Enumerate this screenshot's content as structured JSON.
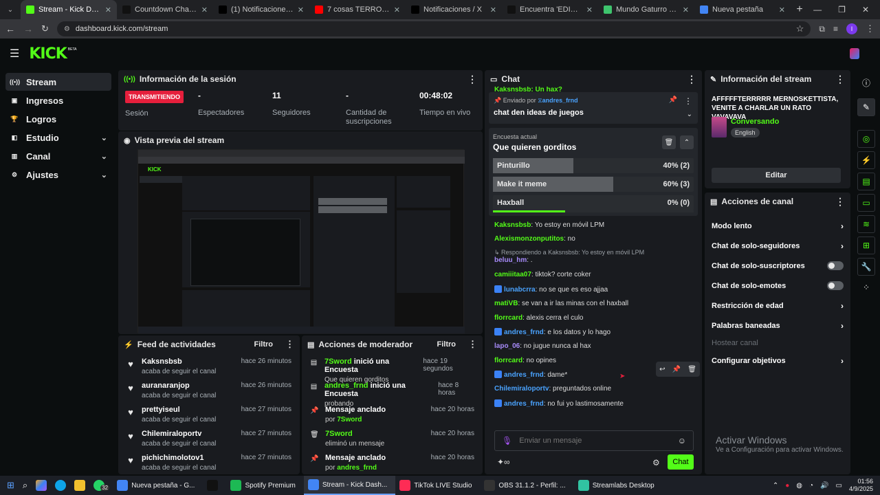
{
  "browser": {
    "tabs": [
      {
        "title": "Stream - Kick Dashboard",
        "color": "#53fc18",
        "active": true
      },
      {
        "title": "Countdown Challenge wi",
        "color": "#111111"
      },
      {
        "title": "(1) Notificaciones / X",
        "color": "#000000"
      },
      {
        "title": "7 cosas TERRORIFICAS co",
        "color": "#ff0000"
      },
      {
        "title": "Notificaciones / X",
        "color": "#000000"
      },
      {
        "title": "Encuentra 'EDIT MESSI YO",
        "color": "#111111"
      },
      {
        "title": "Mundo Gaturro - Login",
        "color": "#3ec46d"
      },
      {
        "title": "Nueva pestaña",
        "color": "#4285f4"
      }
    ],
    "url": "dashboard.kick.com/stream",
    "profile": "I"
  },
  "logo": {
    "text": "KICK",
    "badge": "BETA"
  },
  "sidebar": {
    "items": [
      {
        "label": "Stream",
        "icon": "broadcast-icon",
        "active": true
      },
      {
        "label": "Ingresos",
        "icon": "wallet-icon"
      },
      {
        "label": "Logros",
        "icon": "trophy-icon"
      },
      {
        "label": "Estudio",
        "icon": "studio-icon",
        "chevron": true
      },
      {
        "label": "Canal",
        "icon": "channel-icon",
        "chevron": true
      },
      {
        "label": "Ajustes",
        "icon": "gear-icon",
        "chevron": true
      }
    ]
  },
  "session": {
    "title": "Información de la sesión",
    "live": "TRANSMITIENDO",
    "session_label": "Sesión",
    "stats": [
      {
        "value": "-",
        "label": "Espectadores"
      },
      {
        "value": "11",
        "label": "Seguidores"
      },
      {
        "value": "-",
        "label": "Cantidad de suscripciones"
      },
      {
        "value": "00:48:02",
        "label": "Tiempo en vivo"
      }
    ]
  },
  "preview": {
    "title": "Vista previa del stream"
  },
  "feed": {
    "title": "Feed de actividades",
    "filter": "Filtro",
    "items": [
      {
        "name": "Kaksnsbsb",
        "sub": "acaba de seguir el canal",
        "time": "hace 26 minutos"
      },
      {
        "name": "auranaranjop",
        "sub": "acaba de seguir el canal",
        "time": "hace 26 minutos"
      },
      {
        "name": "prettyiseul",
        "sub": "acaba de seguir el canal",
        "time": "hace 27 minutos"
      },
      {
        "name": "Chilemiraloportv",
        "sub": "acaba de seguir el canal",
        "time": "hace 27 minutos"
      },
      {
        "name": "pichichimolotov1",
        "sub": "acaba de seguir el canal",
        "time": "hace 27 minutos"
      }
    ]
  },
  "modactions": {
    "title": "Acciones de moderador",
    "filter": "Filtro",
    "items": [
      {
        "user": "7Sword",
        "action": " inició una Encuesta",
        "sub": "Que quieren gorditos",
        "time": "hace 19 segundos",
        "icon": "poll-icon"
      },
      {
        "user": "andres_frnd",
        "action": " inició una Encuesta",
        "sub": "probando",
        "time": "hace 8 horas",
        "icon": "poll-icon"
      },
      {
        "user": "",
        "action": "Mensaje anclado",
        "sub_prefix": "por ",
        "sub": "7Sword",
        "time": "hace 20 horas",
        "icon": "pin-icon"
      },
      {
        "user": "7Sword",
        "action": "",
        "sub": "eliminó un mensaje",
        "time": "hace 20 horas",
        "icon": "trash-icon"
      },
      {
        "user": "",
        "action": "Mensaje anclado",
        "sub_prefix": "por ",
        "sub": "andres_frnd",
        "time": "hace 20 horas",
        "icon": "pin-icon"
      }
    ]
  },
  "chat": {
    "title": "Chat",
    "top_partial": "Kaksnsbsb: Un hax?",
    "pinned": {
      "by_label": "Enviado por",
      "by": "andres_frnd",
      "text": "chat den ideas de juegos"
    },
    "poll": {
      "label": "Encuesta actual",
      "question": "Que quieren gorditos",
      "options": [
        {
          "label": "Pinturillo",
          "pct": "40% (2)",
          "fraction": 0.4
        },
        {
          "label": "Make it meme",
          "pct": "60% (3)",
          "fraction": 0.6
        },
        {
          "label": "Haxball",
          "pct": "0% (0)",
          "fraction": 0.0
        }
      ],
      "time_remaining_fraction": 0.36
    },
    "messages": [
      {
        "user": "Kaksnsbsb",
        "color": "#53fc18",
        "text": ": Yo estoy en móvil LPM"
      },
      {
        "user": "Alexismonzonputitos",
        "color": "#53fc18",
        "text": ": no"
      },
      {
        "reply": "Respondiendo a Kaksnsbsb: Yo estoy en móvil LPM"
      },
      {
        "user": "beluu_hm",
        "color": "#a78bfa",
        "text": ": ."
      },
      {
        "user": "camiiitaa07",
        "color": "#53fc18",
        "text": ": tiktok? corte coker"
      },
      {
        "user": "lunabcrra",
        "color": "#4aa3ff",
        "text": ": no se que es eso ajjaa",
        "badge": true
      },
      {
        "user": "matiVB",
        "color": "#53fc18",
        "text": ": se van a ir las minas con el haxball"
      },
      {
        "user": "florrcard",
        "color": "#53fc18",
        "text": ": alexis cerra el culo"
      },
      {
        "user": "andres_frnd",
        "color": "#4aa3ff",
        "text": ": e los datos y lo hago",
        "badge": true
      },
      {
        "user": "lapo_06",
        "color": "#a78bfa",
        "text": ": no jugue nunca al hax"
      },
      {
        "user": "florrcard",
        "color": "#53fc18",
        "text": ": no opines"
      },
      {
        "user": "andres_frnd",
        "color": "#4aa3ff",
        "text": ": dame*",
        "badge": true
      },
      {
        "user": "Chilemiraloportv",
        "color": "#4aa3ff",
        "text": ": preguntados online"
      },
      {
        "user": "andres_frnd",
        "color": "#4aa3ff",
        "text": ": no fui yo lastimosamente",
        "badge": true
      }
    ],
    "input_placeholder": "Enviar un mensaje",
    "send_label": "Chat"
  },
  "streaminfo": {
    "title": "Información del stream",
    "stream_title": "AFFFFFTERRRRR MERNOSKETTISTA, VENITE A CHARLAR UN RATO VAVAVAVA",
    "category": "Conversando",
    "language": "English",
    "edit_label": "Editar"
  },
  "channelactions": {
    "title": "Acciones de canal",
    "items": [
      {
        "label": "Modo lento",
        "type": "chevron"
      },
      {
        "label": "Chat de solo-seguidores",
        "type": "chevron"
      },
      {
        "label": "Chat de solo-suscriptores",
        "type": "toggle"
      },
      {
        "label": "Chat de solo-emotes",
        "type": "toggle"
      },
      {
        "label": "Restricción de edad",
        "type": "chevron"
      },
      {
        "label": "Palabras baneadas",
        "type": "chevron"
      },
      {
        "label": "Hostear canal",
        "type": "disabled"
      },
      {
        "label": "Configurar objetivos",
        "type": "chevron"
      }
    ]
  },
  "watermark": {
    "line1": "Activar Windows",
    "line2": "Ve a Configuración para activar Windows."
  },
  "taskbar": {
    "items": [
      {
        "label": "Nueva pestaña - G...",
        "color": "#4285f4"
      },
      {
        "label": "",
        "color": "#111"
      },
      {
        "label": "Spotify Premium",
        "color": "#1db954"
      },
      {
        "label": "Stream - Kick Dash...",
        "color": "#4285f4",
        "active": true
      },
      {
        "label": "TikTok LIVE Studio",
        "color": "#fe2c55"
      },
      {
        "label": "OBS 31.1.2 - Perfil: ...",
        "color": "#333"
      },
      {
        "label": "Streamlabs Desktop",
        "color": "#31c3a2"
      }
    ],
    "whatsapp_badge": "32",
    "time": "01:56",
    "date": "4/9/2025"
  }
}
